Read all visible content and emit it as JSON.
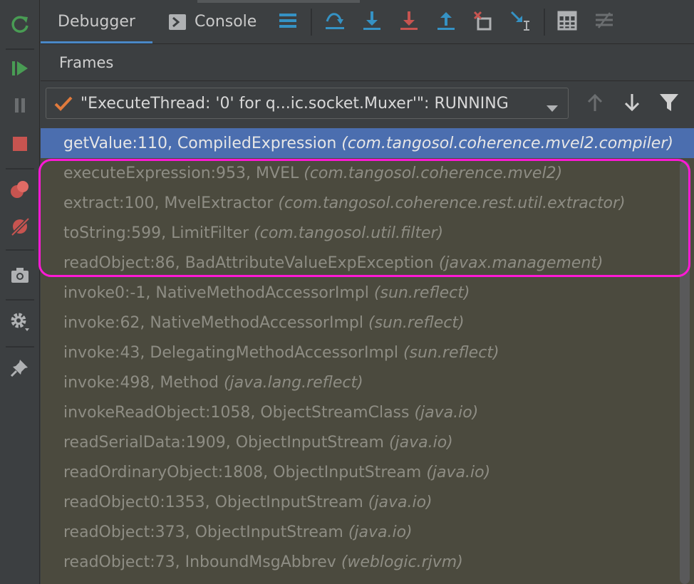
{
  "tabs": [
    {
      "label": "Debugger",
      "selected": true,
      "icon": null
    },
    {
      "label": "Console",
      "selected": false,
      "icon": "console-icon"
    }
  ],
  "frames_title": "Frames",
  "thread": {
    "label": "\"ExecuteThread: '0' for q...ic.socket.Muxer'\": RUNNING",
    "icon": "check-icon"
  },
  "frames": [
    {
      "method": "getValue:110, CompiledExpression",
      "pkg": "(com.tangosol.coherence.mvel2.compiler)",
      "selected": true
    },
    {
      "method": "executeExpression:953, MVEL",
      "pkg": "(com.tangosol.coherence.mvel2)"
    },
    {
      "method": "extract:100, MvelExtractor",
      "pkg": "(com.tangosol.coherence.rest.util.extractor)"
    },
    {
      "method": "toString:599, LimitFilter",
      "pkg": "(com.tangosol.util.filter)"
    },
    {
      "method": "readObject:86, BadAttributeValueExpException",
      "pkg": "(javax.management)"
    },
    {
      "method": "invoke0:-1, NativeMethodAccessorImpl",
      "pkg": "(sun.reflect)"
    },
    {
      "method": "invoke:62, NativeMethodAccessorImpl",
      "pkg": "(sun.reflect)"
    },
    {
      "method": "invoke:43, DelegatingMethodAccessorImpl",
      "pkg": "(sun.reflect)"
    },
    {
      "method": "invoke:498, Method",
      "pkg": "(java.lang.reflect)"
    },
    {
      "method": "invokeReadObject:1058, ObjectStreamClass",
      "pkg": "(java.io)"
    },
    {
      "method": "readSerialData:1909, ObjectInputStream",
      "pkg": "(java.io)"
    },
    {
      "method": "readOrdinaryObject:1808, ObjectInputStream",
      "pkg": "(java.io)"
    },
    {
      "method": "readObject0:1353, ObjectInputStream",
      "pkg": "(java.io)"
    },
    {
      "method": "readObject:373, ObjectInputStream",
      "pkg": "(java.io)"
    },
    {
      "method": "readObject:73, InboundMsgAbbrev",
      "pkg": "(weblogic.rjvm)"
    }
  ],
  "left_toolbar_icons": [
    "rerun-icon",
    "resume-icon",
    "pause-icon",
    "stop-icon",
    "view-breakpoints-icon",
    "mute-breakpoints-icon",
    "camera-icon",
    "settings-icon",
    "pin-icon"
  ],
  "top_toolbar_icons": [
    "layout-menu-icon",
    "step-over-icon",
    "step-into-icon",
    "force-step-into-icon",
    "step-out-icon",
    "drop-frame-icon",
    "run-to-cursor-icon",
    "evaluate-expression-icon",
    "trace-icon"
  ],
  "colors": {
    "panel_bg": "#3c3f41",
    "frames_bg": "#4b4a3e",
    "selection": "#4b6eaf",
    "annotation": "#ff19d6",
    "accent_blue": "#3592c4",
    "accent_red": "#c75450",
    "accent_green": "#499c54"
  }
}
